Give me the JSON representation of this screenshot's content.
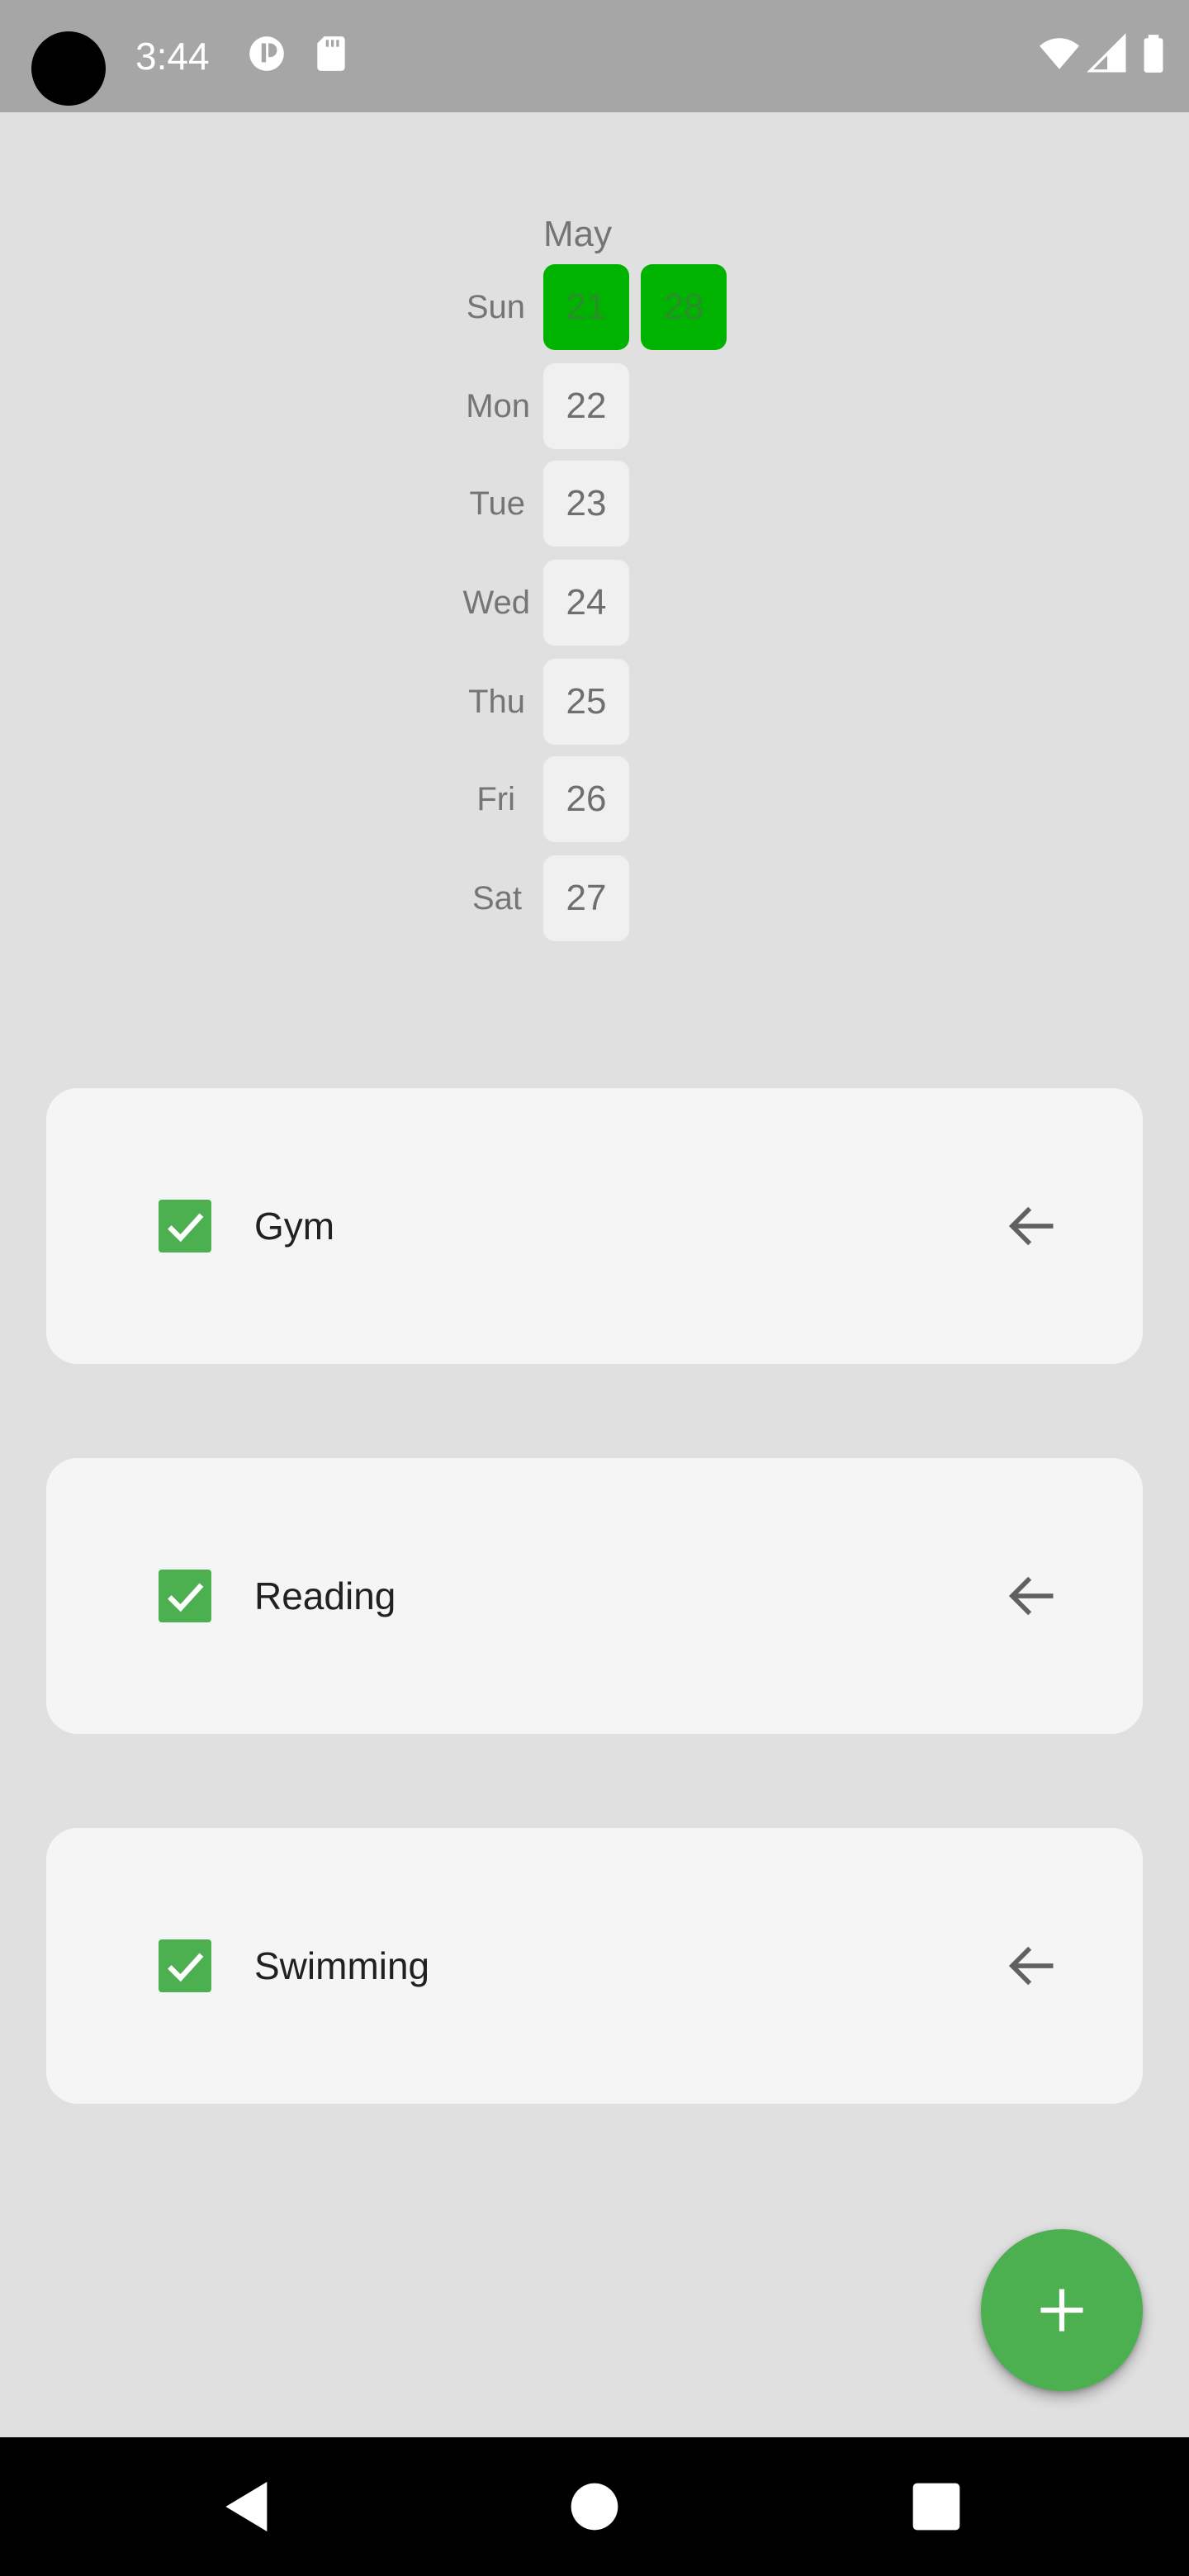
{
  "status_bar": {
    "time": "3:44",
    "icons": [
      "camera-cutout",
      "app-notification-icon",
      "sd-card-icon",
      "wifi-icon",
      "cellular-signal-icon",
      "battery-icon"
    ]
  },
  "calendar": {
    "month": "May",
    "weekdays": [
      "Sun",
      "Mon",
      "Tue",
      "Wed",
      "Thu",
      "Fri",
      "Sat"
    ],
    "week1": [
      "21",
      "22",
      "23",
      "24",
      "25",
      "26",
      "27"
    ],
    "week2": [
      "28"
    ],
    "completed_days": [
      "21",
      "28"
    ],
    "completed_color": "#00b300"
  },
  "habits": [
    {
      "name": "Gym",
      "checked": true
    },
    {
      "name": "Reading",
      "checked": true
    },
    {
      "name": "Swimming",
      "checked": true
    }
  ],
  "colors": {
    "accent": "#4caf50",
    "background": "#e0e0e0",
    "card": "#f5f5f5"
  },
  "fab": {
    "icon": "plus-icon"
  },
  "nav_bar": {
    "buttons": [
      "back-icon",
      "home-icon",
      "recents-icon"
    ]
  }
}
